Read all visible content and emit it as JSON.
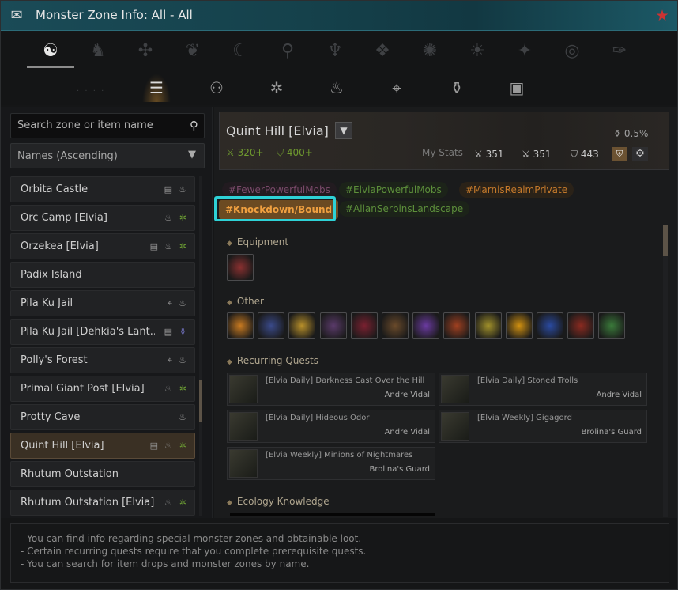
{
  "window": {
    "title": "Monster Zone Info: All - All"
  },
  "categories": [
    {
      "name": "all-icon",
      "glyph": "☯",
      "active": true
    },
    {
      "name": "horse-icon",
      "glyph": "♞"
    },
    {
      "name": "beast-icon",
      "glyph": "✣"
    },
    {
      "name": "wings-icon",
      "glyph": "❦"
    },
    {
      "name": "moon-icon",
      "glyph": "☾"
    },
    {
      "name": "key-icon",
      "glyph": "⚲"
    },
    {
      "name": "trident-icon",
      "glyph": "♆"
    },
    {
      "name": "flame-icon",
      "glyph": "❖"
    },
    {
      "name": "gear-emblem-icon",
      "glyph": "✺"
    },
    {
      "name": "sun-icon",
      "glyph": "☀"
    },
    {
      "name": "star-icon",
      "glyph": "✦"
    },
    {
      "name": "swirl-icon",
      "glyph": "◎"
    },
    {
      "name": "feather-icon",
      "glyph": "✑"
    }
  ],
  "subcategories": [
    {
      "name": "list-icon",
      "glyph": "☰",
      "active": true
    },
    {
      "name": "monster-search-icon",
      "glyph": "⚇"
    },
    {
      "name": "wheel-icon",
      "glyph": "✲"
    },
    {
      "name": "campfire-icon",
      "glyph": "♨"
    },
    {
      "name": "telescope-icon",
      "glyph": "⌖"
    },
    {
      "name": "potion-icon",
      "glyph": "⚱"
    },
    {
      "name": "portrait-icon",
      "glyph": "▣"
    }
  ],
  "search": {
    "placeholder": "Search zone or item name"
  },
  "sort": {
    "label": "Names (Ascending)"
  },
  "zones": [
    {
      "name": "Orbita Castle",
      "icons": [
        "book",
        "campfire"
      ]
    },
    {
      "name": "Orc Camp [Elvia]",
      "icons": [
        "campfire",
        "wheel"
      ]
    },
    {
      "name": "Orzekea [Elvia]",
      "icons": [
        "book",
        "campfire",
        "wheel"
      ]
    },
    {
      "name": "Padix Island",
      "icons": []
    },
    {
      "name": "Pila Ku Jail",
      "icons": [
        "telescope",
        "campfire"
      ]
    },
    {
      "name": "Pila Ku Jail [Dehkia's Lant...",
      "icons": [
        "book",
        "potion"
      ]
    },
    {
      "name": "Polly's Forest",
      "icons": [
        "telescope",
        "campfire"
      ]
    },
    {
      "name": "Primal Giant Post [Elvia]",
      "icons": [
        "campfire",
        "wheel"
      ]
    },
    {
      "name": "Protty Cave",
      "icons": [
        "campfire"
      ]
    },
    {
      "name": "Quint Hill [Elvia]",
      "icons": [
        "book",
        "campfire",
        "wheel"
      ],
      "selected": true
    },
    {
      "name": "Rhutum Outstation",
      "icons": []
    },
    {
      "name": "Rhutum Outstation [Elvia]",
      "icons": [
        "campfire",
        "wheel"
      ]
    }
  ],
  "zone_info": {
    "title": "Quint Hill [Elvia]",
    "ap": "320+",
    "dp": "400+",
    "my_stats_label": "My Stats",
    "my_ap": "351",
    "my_awk_ap": "351",
    "my_dp": "443",
    "drop_rate": "0.5%"
  },
  "tags": [
    {
      "label": "#FewerPowerfulMobs",
      "style": "p"
    },
    {
      "label": "#ElviaPowerfulMobs",
      "style": "g"
    },
    {
      "label": "#MarnisRealmPrivate",
      "style": "o"
    },
    {
      "label": "#Knockdown/Bound",
      "style": "hl"
    },
    {
      "label": "#AllanSerbinsLandscape",
      "style": "g"
    }
  ],
  "sections": {
    "equipment": "Equipment",
    "other": "Other",
    "recurring": "Recurring Quests",
    "ecology": "Ecology Knowledge"
  },
  "equipment_items": [
    {
      "name": "boots-item",
      "color": "#8a3030"
    }
  ],
  "other_items": [
    {
      "name": "orb-fire-item",
      "color": "#c87a20"
    },
    {
      "name": "blue-stone-item",
      "color": "#3a4a8a"
    },
    {
      "name": "gold-ring-item",
      "color": "#b8902a"
    },
    {
      "name": "dark-orb-item",
      "color": "#5a3a6a"
    },
    {
      "name": "red-gem-item",
      "color": "#7a2030"
    },
    {
      "name": "chest-item",
      "color": "#6a4a2a"
    },
    {
      "name": "purple-crystal-item",
      "color": "#6a3aa0"
    },
    {
      "name": "red-orb-item",
      "color": "#a04020"
    },
    {
      "name": "gold-nugget-item",
      "color": "#a0902a"
    },
    {
      "name": "amber-drop-item",
      "color": "#d09010"
    },
    {
      "name": "blue-rune-item",
      "color": "#2a4aa0"
    },
    {
      "name": "red-book-item",
      "color": "#8a2a20"
    },
    {
      "name": "green-stone-item",
      "color": "#3a7a3a"
    }
  ],
  "quests": [
    {
      "title": "[Elvia Daily] Darkness Cast Over the Hill",
      "npc": "Andre Vidal"
    },
    {
      "title": "[Elvia Daily] Stoned Trolls",
      "npc": "Andre Vidal"
    },
    {
      "title": "[Elvia Daily] Hideous Odor",
      "npc": "Andre Vidal"
    },
    {
      "title": "[Elvia Weekly] Gigagord",
      "npc": "Brolina's Guard"
    },
    {
      "title": "[Elvia Weekly] Minions of Nightmares",
      "npc": "Brolina's Guard"
    }
  ],
  "footer": {
    "line1": "- You can find info regarding special monster zones and obtainable loot.",
    "line2": "- Certain recurring quests require that you complete prerequisite quests.",
    "line3": "- You can search for item drops and monster zones by name."
  }
}
